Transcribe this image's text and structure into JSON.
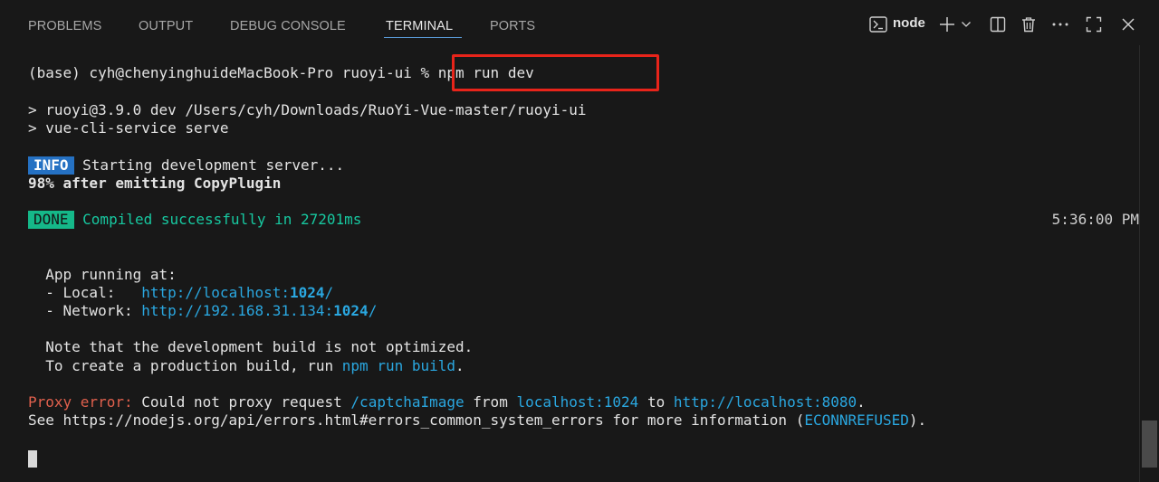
{
  "tabs": [
    {
      "label": "PROBLEMS",
      "active": false
    },
    {
      "label": "OUTPUT",
      "active": false
    },
    {
      "label": "DEBUG CONSOLE",
      "active": false
    },
    {
      "label": "TERMINAL",
      "active": true
    },
    {
      "label": "PORTS",
      "active": false
    }
  ],
  "toolbar": {
    "shell_label": "node",
    "icons": [
      "terminal-shell-icon",
      "plus-icon",
      "chevron-down-icon",
      "split-terminal-icon",
      "trash-icon",
      "more-icon",
      "maximize-icon",
      "close-icon"
    ]
  },
  "terminal": {
    "prompt": "(base) cyh@chenyinghuideMacBook-Pro ruoyi-ui % ",
    "command": "npm run dev",
    "script_line1": "> ruoyi@3.9.0 dev /Users/cyh/Downloads/RuoYi-Vue-master/ruoyi-ui",
    "script_line2": "> vue-cli-service serve",
    "info_badge": "INFO",
    "info_text": " Starting development server...",
    "progress_text": "98% after emitting CopyPlugin",
    "done_badge": "DONE",
    "done_text": " Compiled successfully in 27201ms",
    "timestamp": "5:36:00 PM",
    "app_running": "  App running at:",
    "local_prefix": "  - Local:   ",
    "local_url_base": "http://localhost:",
    "local_port": "1024",
    "local_suffix": "/",
    "network_prefix": "  - Network: ",
    "network_url_base": "http://192.168.31.134:",
    "network_port": "1024",
    "network_suffix": "/",
    "note_line1": "  Note that the development build is not optimized.",
    "note_line2_prefix": "  To create a production build, run ",
    "note_line2_cmd": "npm run build",
    "note_line2_suffix": ".",
    "proxy_error_label": "Proxy error:",
    "proxy_text1": " Could not proxy request ",
    "proxy_path": "/captchaImage",
    "proxy_text2": " from ",
    "proxy_from": "localhost:1024",
    "proxy_text3": " to ",
    "proxy_to": "http://localhost:8080",
    "proxy_text4": ".",
    "see_text1": "See https://nodejs.org/api/errors.html#errors_common_system_errors for more information (",
    "see_code": "ECONNREFUSED",
    "see_text2": ")."
  },
  "colors": {
    "background": "#181818",
    "url": "#2aa7e0",
    "error": "#e0604d",
    "success": "#17c8a0",
    "info_badge": "#2571c3",
    "done_badge": "#15b889",
    "highlight_box": "#e8241a",
    "active_tab_underline": "#5a9bd8"
  }
}
